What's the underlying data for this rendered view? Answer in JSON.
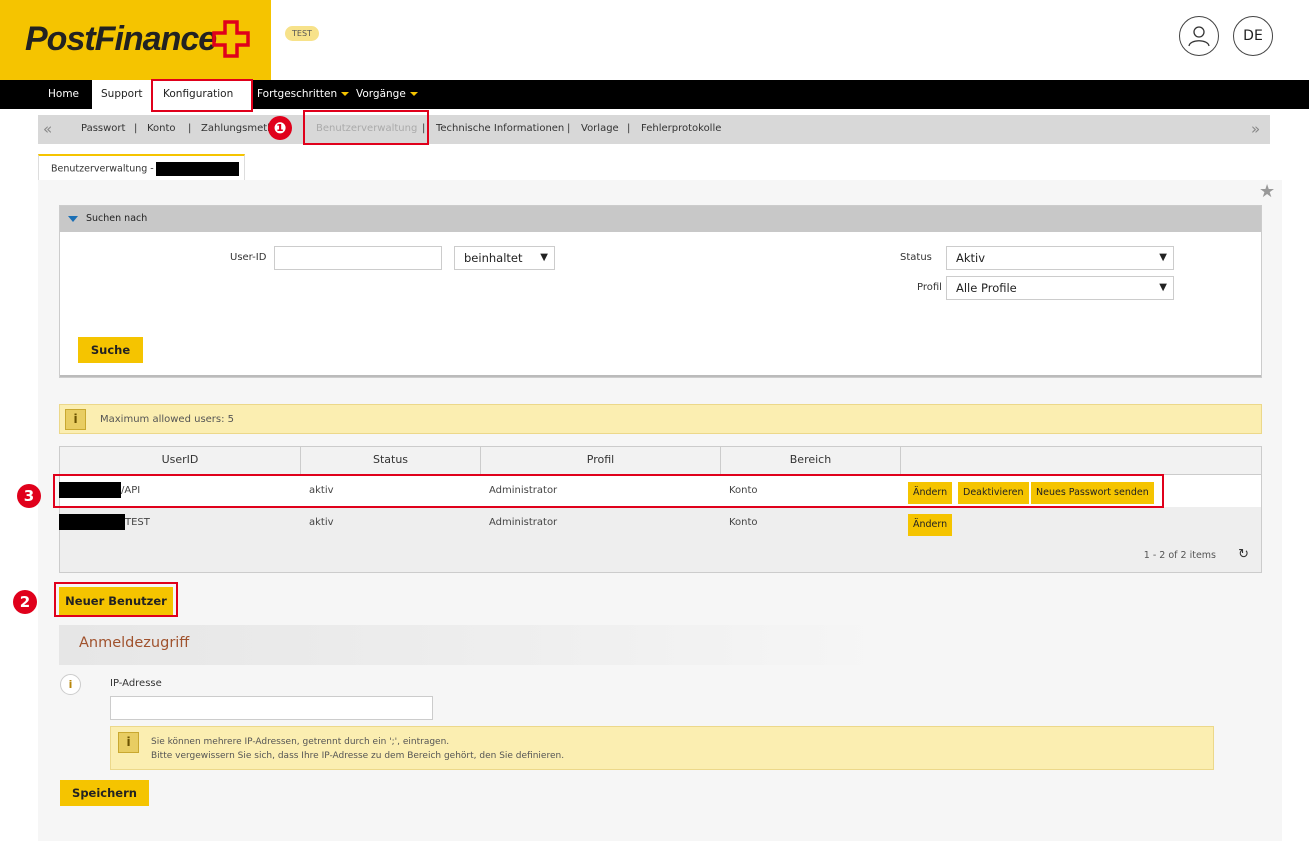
{
  "header": {
    "logo_text": "PostFinance",
    "env_badge": "TEST",
    "language": "DE",
    "brand_yellow": "#f5c400",
    "user_icon": "user-icon"
  },
  "main_nav": {
    "items": [
      {
        "label": "Home",
        "dropdown": false
      },
      {
        "label": "Support",
        "dropdown": false
      },
      {
        "label": "Konfiguration",
        "dropdown": true
      },
      {
        "label": "Fortgeschritten",
        "dropdown": true
      },
      {
        "label": "Vorgänge",
        "dropdown": true
      }
    ]
  },
  "sub_nav": {
    "items": [
      {
        "label": "Passwort"
      },
      {
        "label": "Konto"
      },
      {
        "label": "Zahlungsmeth"
      },
      {
        "label": "Benutzerverwaltung"
      },
      {
        "label": "Technische Informationen"
      },
      {
        "label": "Vorlage"
      },
      {
        "label": "Fehlerprotokolle"
      }
    ],
    "separator": "|"
  },
  "tab": {
    "label": "Benutzerverwaltung -"
  },
  "search": {
    "header": "Suchen nach",
    "userid_label": "User-ID",
    "userid_value": "",
    "match_select": "beinhaltet",
    "status_label": "Status",
    "status_select": "Aktiv",
    "profil_label": "Profil",
    "profil_select": "Alle Profile",
    "search_button": "Suche"
  },
  "info": {
    "max_users": "Maximum allowed users: 5",
    "info_icon": "i"
  },
  "table": {
    "columns": [
      "UserID",
      "Status",
      "Profil",
      "Bereich",
      ""
    ],
    "rows": [
      {
        "userid_suffix": "/API",
        "status": "aktiv",
        "profil": "Administrator",
        "bereich": "Konto",
        "actions": [
          "Ändern",
          "Deaktivieren",
          "Neues Passwort senden"
        ]
      },
      {
        "userid_suffix": "TEST",
        "status": "aktiv",
        "profil": "Administrator",
        "bereich": "Konto",
        "actions": [
          "Ändern"
        ]
      }
    ],
    "pager": "1 - 2 of 2 items",
    "refresh_icon": "↻"
  },
  "new_user_button": "Neuer Benutzer",
  "anmeldezugriff": {
    "title": "Anmeldezugriff",
    "ip_label": "IP-Adresse",
    "ip_value": "",
    "hint_line1": "Sie können mehrere IP-Adressen, getrennt durch ein ';', eintragen.",
    "hint_line2": "Bitte vergewissern Sie sich, dass Ihre IP-Adresse zu dem Bereich gehört, den Sie definieren.",
    "save_button": "Speichern"
  },
  "annotations": {
    "badge1": "❶",
    "badge2": "2",
    "badge3": "3",
    "annotation_red": "#e0001b"
  }
}
